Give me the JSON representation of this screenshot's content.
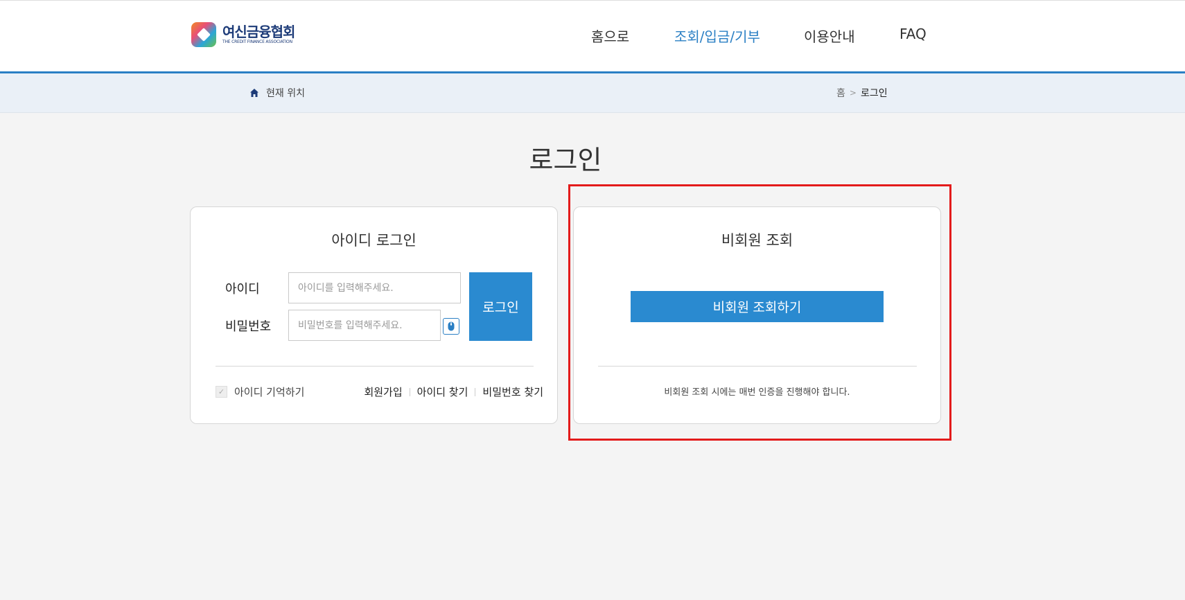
{
  "header": {
    "logo_text_ko": "여신금융협회",
    "logo_text_en": "THE CREDIT FINANCE ASSOCIATION",
    "nav": [
      {
        "label": "홈으로",
        "active": false
      },
      {
        "label": "조회/입금/기부",
        "active": true
      },
      {
        "label": "이용안내",
        "active": false
      },
      {
        "label": "FAQ",
        "active": false
      }
    ]
  },
  "breadcrumb": {
    "location_label": "현재 위치",
    "home": "홈",
    "separator": ">",
    "current": "로그인"
  },
  "page": {
    "title": "로그인"
  },
  "id_login": {
    "title": "아이디 로그인",
    "id_label": "아이디",
    "id_placeholder": "아이디를 입력해주세요.",
    "pw_label": "비밀번호",
    "pw_placeholder": "비밀번호를 입력해주세요.",
    "login_button": "로그인",
    "remember_label": "아이디 기억하기",
    "links": [
      "회원가입",
      "아이디 찾기",
      "비밀번호 찾기"
    ]
  },
  "nonmember": {
    "title": "비회원 조회",
    "button": "비회원 조회하기",
    "notice": "비회원 조회 시에는 매번 인증을 진행해야 합니다."
  },
  "colors": {
    "accent": "#2a8ad0",
    "highlight": "#e31b1b"
  }
}
